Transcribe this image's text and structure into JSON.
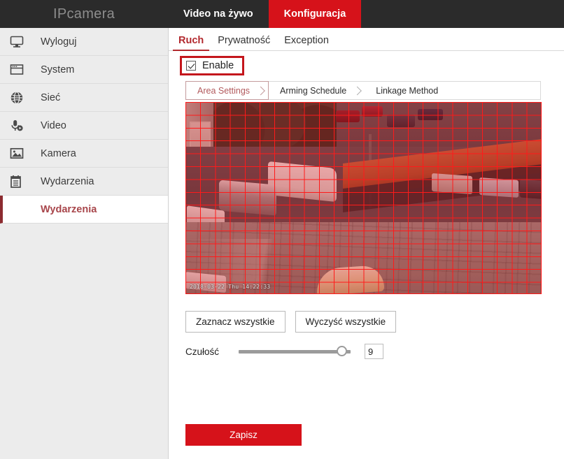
{
  "header": {
    "brand": "IPcamera",
    "nav": [
      {
        "label": "Video na żywo",
        "active": false
      },
      {
        "label": "Konfiguracja",
        "active": true
      }
    ]
  },
  "sidebar": {
    "items": [
      {
        "label": "Wyloguj",
        "icon": "monitor-icon"
      },
      {
        "label": "System",
        "icon": "window-icon"
      },
      {
        "label": "Sieć",
        "icon": "globe-icon"
      },
      {
        "label": "Video",
        "icon": "microphone-icon"
      },
      {
        "label": "Kamera",
        "icon": "image-icon"
      },
      {
        "label": "Wydarzenia",
        "icon": "notepad-icon"
      }
    ],
    "active_sub": "Wydarzenia"
  },
  "main": {
    "tabs": [
      {
        "label": "Ruch",
        "active": true
      },
      {
        "label": "Prywatność",
        "active": false
      },
      {
        "label": "Exception",
        "active": false
      }
    ],
    "enable": {
      "label": "Enable",
      "checked": true,
      "highlight_color": "#c4161c"
    },
    "subtabs": [
      {
        "label": "Area Settings",
        "active": true
      },
      {
        "label": "Arming Schedule",
        "active": false
      },
      {
        "label": "Linkage Method",
        "active": false
      }
    ],
    "video": {
      "osd_timestamp": "2018-03-22 Thu 14:22:33",
      "grid_color": "#ff1a1a",
      "grid_columns": 24,
      "grid_rows": 15,
      "all_cells_selected": true
    },
    "buttons": {
      "select_all": "Zaznacz wszystkie",
      "clear_all": "Wyczyść wszystkie",
      "save": "Zapisz"
    },
    "sensitivity": {
      "label": "Czułość",
      "value": "9",
      "min": "0",
      "max": "10"
    }
  },
  "colors": {
    "accent_red": "#d6121a",
    "header_dark": "#2b2b2b",
    "sidebar_bg": "#ececec",
    "active_link": "#a8464b"
  }
}
